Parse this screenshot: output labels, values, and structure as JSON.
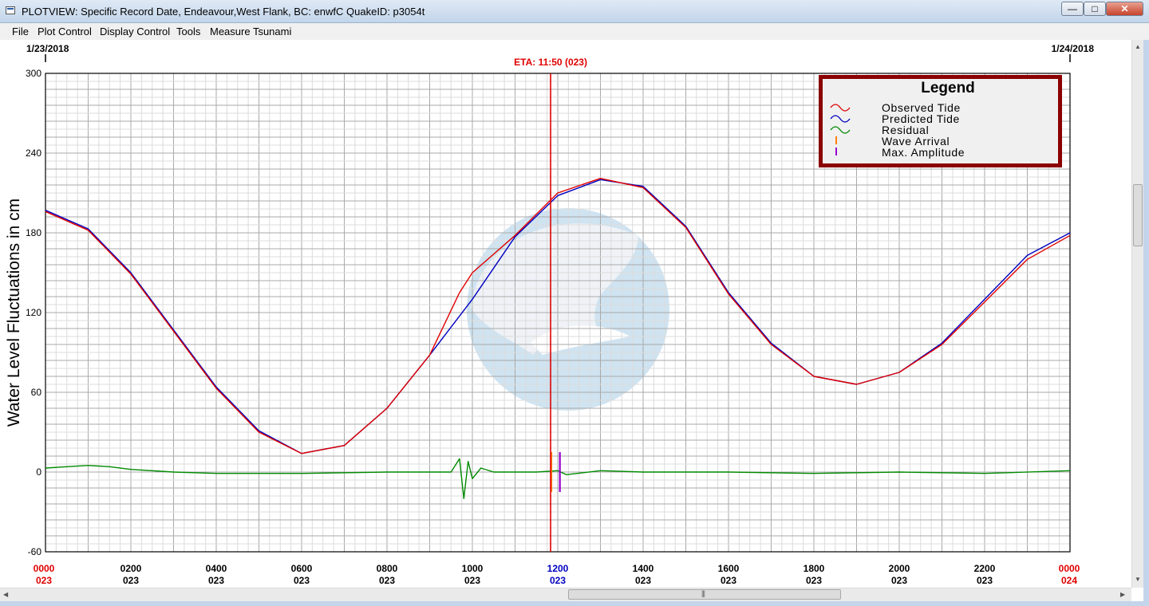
{
  "window": {
    "title": "PLOTVIEW: Specific Record Date, Endeavour,West Flank, BC: enwfC     QuakeID: p3054t",
    "minimize_glyph": "—",
    "maximize_glyph": "□",
    "close_glyph": "✕"
  },
  "menu": {
    "items": [
      "File",
      "Plot Control",
      "Display Control",
      "Tools",
      "Measure Tsunami"
    ]
  },
  "colors": {
    "observed": "#e00000",
    "predicted": "#0000c0",
    "residual": "#008a00",
    "wave_arrival": "#ff7f00",
    "max_amplitude": "#9900cc",
    "eta_line": "#e00000",
    "legend_border": "#8b0000",
    "noaa_logo": "#a8cde6"
  },
  "chart_data": {
    "type": "line",
    "date_start": "1/23/2018",
    "date_end": "1/24/2018",
    "eta_label": "ETA: 11:50 (023)",
    "eta_hour": 11.833,
    "ylabel": "Water Level Fluctuations in cm",
    "ylim": [
      -60,
      300
    ],
    "y_ticks": [
      300,
      240,
      180,
      120,
      60,
      0,
      -60
    ],
    "xlim": [
      0,
      24
    ],
    "x_ticks": [
      {
        "hour": 0,
        "time": "0000",
        "day": "023",
        "color": "#e00000"
      },
      {
        "hour": 2,
        "time": "0200",
        "day": "023",
        "color": "#000000"
      },
      {
        "hour": 4,
        "time": "0400",
        "day": "023",
        "color": "#000000"
      },
      {
        "hour": 6,
        "time": "0600",
        "day": "023",
        "color": "#000000"
      },
      {
        "hour": 8,
        "time": "0800",
        "day": "023",
        "color": "#000000"
      },
      {
        "hour": 10,
        "time": "1000",
        "day": "023",
        "color": "#000000"
      },
      {
        "hour": 12,
        "time": "1200",
        "day": "023",
        "color": "#0000c0"
      },
      {
        "hour": 14,
        "time": "1400",
        "day": "023",
        "color": "#000000"
      },
      {
        "hour": 16,
        "time": "1600",
        "day": "023",
        "color": "#000000"
      },
      {
        "hour": 18,
        "time": "1800",
        "day": "023",
        "color": "#000000"
      },
      {
        "hour": 20,
        "time": "2000",
        "day": "023",
        "color": "#000000"
      },
      {
        "hour": 22,
        "time": "2200",
        "day": "023",
        "color": "#000000"
      },
      {
        "hour": 24,
        "time": "0000",
        "day": "024",
        "color": "#e00000"
      }
    ],
    "grid": true,
    "legend_position": "top-right",
    "legend_title": "Legend",
    "legend": [
      "Observed Tide",
      "Predicted Tide",
      "Residual",
      "Wave Arrival",
      "Max. Amplitude"
    ],
    "series": [
      {
        "name": "Predicted Tide",
        "x": [
          0,
          1,
          2,
          3,
          4,
          5,
          6,
          7,
          8,
          9,
          10,
          11,
          12,
          13,
          14,
          15,
          16,
          17,
          18,
          19,
          20,
          21,
          22,
          23,
          24
        ],
        "y": [
          197,
          183,
          150,
          107,
          64,
          31,
          14,
          20,
          48,
          88,
          130,
          177,
          208,
          220,
          215,
          185,
          135,
          97,
          72,
          66,
          75,
          97,
          130,
          163,
          180
        ]
      },
      {
        "name": "Observed Tide",
        "x": [
          0,
          1,
          2,
          3,
          4,
          5,
          6,
          7,
          8,
          9,
          9.7,
          10,
          11,
          12,
          13,
          14,
          15,
          16,
          17,
          18,
          19,
          20,
          21,
          22,
          23,
          24
        ],
        "y": [
          196,
          182,
          149,
          106,
          63,
          30,
          14,
          20,
          48,
          88,
          135,
          150,
          178,
          210,
          221,
          214,
          184,
          134,
          96,
          72,
          66,
          75,
          96,
          128,
          160,
          178
        ]
      },
      {
        "name": "Residual",
        "x": [
          0,
          0.5,
          1,
          1.5,
          2,
          3,
          4,
          5,
          6,
          8,
          9,
          9.5,
          9.7,
          9.8,
          9.9,
          10,
          10.2,
          10.5,
          11,
          11.5,
          12,
          12.2,
          13,
          14,
          16,
          18,
          20,
          22,
          24
        ],
        "y": [
          3,
          4,
          5,
          4,
          2,
          0,
          -1,
          -1,
          -1,
          0,
          0,
          0,
          10,
          -20,
          8,
          -5,
          3,
          0,
          0,
          0,
          1,
          -2,
          1,
          0,
          0,
          -1,
          0,
          -1,
          1
        ]
      }
    ],
    "markers": [
      {
        "name": "Wave Arrival",
        "hour": 11.85,
        "ymin": -15,
        "ymax": 15
      },
      {
        "name": "Max. Amplitude",
        "hour": 12.05,
        "ymin": -15,
        "ymax": 15
      }
    ]
  }
}
